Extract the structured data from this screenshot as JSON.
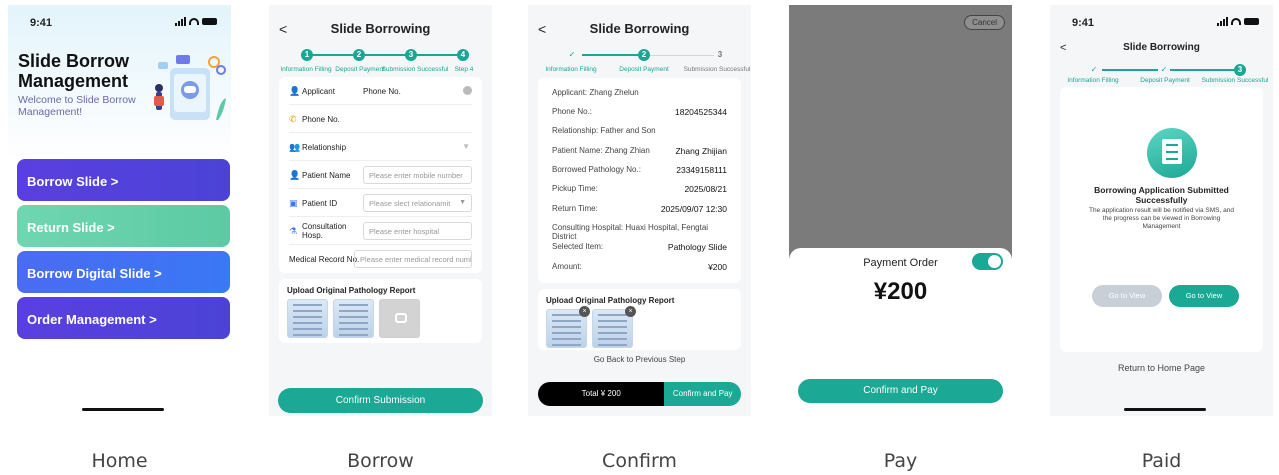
{
  "home": {
    "time": "9:41",
    "title": "Slide Borrow Management",
    "welcome": "Welcome to Slide Borrow Management!",
    "buttons": [
      "Borrow Slide >",
      "Return Slide >",
      "Borrow Digital Slide >",
      "Order Management >"
    ],
    "caption": "Home"
  },
  "borrow": {
    "header": "Slide Borrowing",
    "back": "<",
    "steps": [
      {
        "num": "1",
        "label": "Information Filling"
      },
      {
        "num": "2",
        "label": "Deposit Payment"
      },
      {
        "num": "3",
        "label": "Submission Successful"
      },
      {
        "num": "4",
        "label": "Step 4"
      }
    ],
    "fields": {
      "applicant_label": "Applicant",
      "applicant_value": "Phone No.",
      "phone_label": "Phone No.",
      "relationship_label": "Relationship",
      "patient_name_label": "Patient Name",
      "patient_name_placeholder": "Please enter mobile number",
      "patient_id_label": "Patient ID",
      "patient_id_placeholder": "Please slect relationamit",
      "hospital_label": "Consultation Hosp.",
      "hospital_placeholder": "Please enter hospital",
      "record_label": "Medical Record No.",
      "record_placeholder": "Please enter medical record number"
    },
    "upload_title": "Upload Original Pathology Report",
    "submit": "Confirm Submission",
    "caption": "Borrow"
  },
  "confirm": {
    "header": "Slide Borrowing",
    "back": "<",
    "steps": [
      {
        "num": "✓",
        "label": "Information Filling"
      },
      {
        "num": "2",
        "label": "Deposit Payment"
      },
      {
        "num": "3",
        "label": "Submission Successful"
      }
    ],
    "rows": [
      {
        "label": "Applicant: Zhang Zhelun",
        "value": ""
      },
      {
        "label": "Phone No.:",
        "value": "18204525344"
      },
      {
        "label": "Relationship: Father and Son",
        "value": ""
      },
      {
        "label": "Patient Name: Zhang Zhian",
        "value": "Zhang Zhijian"
      },
      {
        "label": "Borrowed Pathology No.:",
        "value": "23349158111"
      },
      {
        "label": "Pickup Time:",
        "value": "2025/08/21"
      },
      {
        "label": "Return Time:",
        "value": "2025/09/07 12:30"
      },
      {
        "label": "Consulting Hospital: Huaxi Hospital, Fengtai District",
        "value": ""
      },
      {
        "label": "Selected Item:",
        "value": "Pathology Slide"
      },
      {
        "label": "Amount:",
        "value": "¥200"
      }
    ],
    "upload_title": "Upload Original Pathology Report",
    "back_prev": "Go Back to Previous Step",
    "total": "Total ¥ 200",
    "confirm_pay": "Confirm and Pay",
    "caption": "Confirm"
  },
  "pay": {
    "cancel": "Cancel",
    "title": "Payment Order",
    "amount": "¥200",
    "confirm_pay": "Confirm and Pay",
    "caption": "Pay"
  },
  "paid": {
    "time": "9:41",
    "header": "Slide Borrowing",
    "back": "<",
    "steps": [
      {
        "num": "✓",
        "label": "Information Filling"
      },
      {
        "num": "✓",
        "label": "Deposit Payment"
      },
      {
        "num": "3",
        "label": "Submission Successful"
      }
    ],
    "title": "Borrowing Application Submitted Successfully",
    "desc": "The application result will be notified via SMS, and the progress can be viewed in Borrowing Management",
    "btn_disabled": "Go to View",
    "btn_active": "Go to View",
    "return_home": "Return to Home Page",
    "caption": "Paid"
  },
  "colors": {
    "accent": "#1ba894",
    "home_purple": "#4b43d6",
    "home_green": "#5ccaa4",
    "home_blue": "#3a78f5"
  }
}
